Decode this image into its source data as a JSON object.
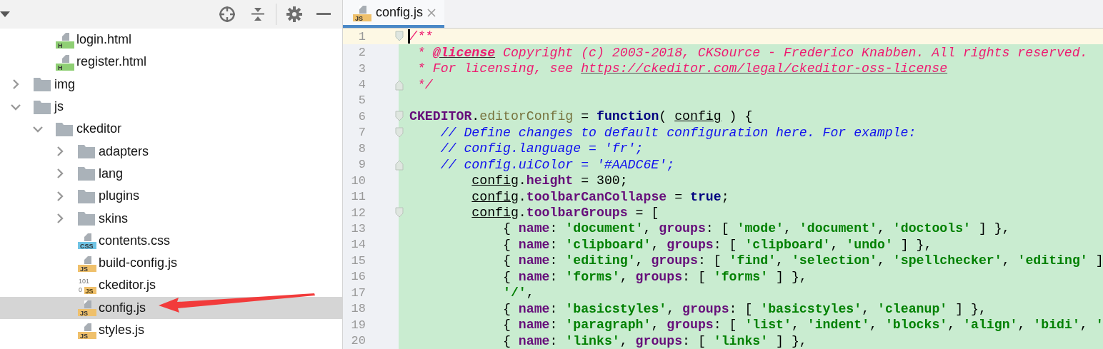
{
  "project_panel": {
    "tree": [
      {
        "children": [
          {
            "kind": "html-file",
            "name": "login.html",
            "badge": "H",
            "selected": false
          },
          {
            "kind": "html-file",
            "name": "register.html",
            "badge": "H",
            "selected": false
          }
        ]
      },
      {
        "kind": "folder",
        "name": "img",
        "expanded": false,
        "selected": false
      },
      {
        "kind": "folder",
        "name": "js",
        "expanded": true,
        "selected": false,
        "children": [
          {
            "kind": "folder",
            "name": "ckeditor",
            "expanded": true,
            "selected": false,
            "children": [
              {
                "kind": "folder",
                "name": "adapters",
                "expanded": false,
                "selected": false
              },
              {
                "kind": "folder",
                "name": "lang",
                "expanded": false,
                "selected": false
              },
              {
                "kind": "folder",
                "name": "plugins",
                "expanded": false,
                "selected": false
              },
              {
                "kind": "folder",
                "name": "skins",
                "expanded": false,
                "selected": false
              },
              {
                "kind": "css-file",
                "name": "contents.css",
                "badge": "CSS",
                "selected": false
              },
              {
                "kind": "js-file",
                "name": "build-config.js",
                "badge": "JS",
                "selected": false
              },
              {
                "kind": "binary-file",
                "name": "ckeditor.js",
                "badge": "JS",
                "bits": [
                  "101",
                  "0"
                ],
                "selected": false
              },
              {
                "kind": "js-file",
                "name": "config.js",
                "badge": "JS",
                "selected": true
              },
              {
                "kind": "js-file",
                "name": "styles.js",
                "badge": "JS",
                "selected": false
              }
            ]
          }
        ]
      }
    ]
  },
  "editor": {
    "tabs": [
      {
        "label": "config.js",
        "badge": "JS",
        "selected": true
      }
    ],
    "lines": [
      {
        "number": "1",
        "current": true,
        "fold_start": true,
        "fold_end": false,
        "tokens": [
          {
            "kind": "doc",
            "text": "/**"
          }
        ]
      },
      {
        "number": "2",
        "current": false,
        "fold_start": false,
        "fold_end": false,
        "tokens": [
          {
            "kind": "doc",
            "text": " * "
          },
          {
            "kind": "doctag",
            "text": "@license"
          },
          {
            "kind": "doc",
            "text": " Copyright (c) 2003-2018, CKSource - Frederico Knabben. All rights reserved."
          }
        ]
      },
      {
        "number": "3",
        "current": false,
        "fold_start": false,
        "fold_end": false,
        "tokens": [
          {
            "kind": "doc",
            "text": " * For licensing, see "
          },
          {
            "kind": "doclink",
            "text": "https://ckeditor.com/legal/ckeditor-oss-license"
          }
        ]
      },
      {
        "number": "4",
        "current": false,
        "fold_start": false,
        "fold_end": true,
        "tokens": [
          {
            "kind": "doc",
            "text": " */"
          }
        ]
      },
      {
        "number": "5",
        "current": false,
        "fold_start": false,
        "fold_end": false
      },
      {
        "number": "6",
        "current": false,
        "fold_start": true,
        "fold_end": false,
        "tokens": [
          {
            "kind": "global",
            "text": "CKEDITOR"
          },
          {
            "kind": "plain",
            "text": "."
          },
          {
            "kind": "method",
            "text": "editorConfig"
          },
          {
            "kind": "plain",
            "text": " = "
          },
          {
            "kind": "keyword",
            "text": "function"
          },
          {
            "kind": "plain",
            "text": "( "
          },
          {
            "kind": "param",
            "text": "config"
          },
          {
            "kind": "plain",
            "text": " ) {"
          }
        ]
      },
      {
        "number": "7",
        "current": false,
        "fold_start": true,
        "fold_end": false,
        "tokens": [
          {
            "kind": "comment",
            "text": "    // Define changes to default configuration here. For example:"
          }
        ]
      },
      {
        "number": "8",
        "current": false,
        "fold_start": false,
        "fold_end": false,
        "tokens": [
          {
            "kind": "comment",
            "text": "    // config.language = 'fr';"
          }
        ]
      },
      {
        "number": "9",
        "current": false,
        "fold_start": false,
        "fold_end": true,
        "tokens": [
          {
            "kind": "comment",
            "text": "    // config.uiColor = '#AADC6E';"
          }
        ]
      },
      {
        "number": "10",
        "current": false,
        "fold_start": false,
        "fold_end": false,
        "tokens": [
          {
            "kind": "param",
            "text": "        config"
          },
          {
            "kind": "plain",
            "text": "."
          },
          {
            "kind": "prop",
            "text": "height"
          },
          {
            "kind": "plain",
            "text": " = 300;"
          }
        ]
      },
      {
        "number": "11",
        "current": false,
        "fold_start": false,
        "fold_end": false,
        "tokens": [
          {
            "kind": "param",
            "text": "        config"
          },
          {
            "kind": "plain",
            "text": "."
          },
          {
            "kind": "prop",
            "text": "toolbarCanCollapse"
          },
          {
            "kind": "plain",
            "text": " = "
          },
          {
            "kind": "keyword",
            "text": "true"
          },
          {
            "kind": "plain",
            "text": ";"
          }
        ]
      },
      {
        "number": "12",
        "current": false,
        "fold_start": true,
        "fold_end": false,
        "tokens": [
          {
            "kind": "param",
            "text": "        config"
          },
          {
            "kind": "plain",
            "text": "."
          },
          {
            "kind": "prop",
            "text": "toolbarGroups"
          },
          {
            "kind": "plain",
            "text": " = ["
          }
        ]
      },
      {
        "number": "13",
        "current": false,
        "fold_start": false,
        "fold_end": false,
        "tokens": [
          {
            "kind": "plain",
            "text": "            { "
          },
          {
            "kind": "prop",
            "text": "name"
          },
          {
            "kind": "plain",
            "text": ": "
          },
          {
            "kind": "string",
            "text": "'document'"
          },
          {
            "kind": "plain",
            "text": ", "
          },
          {
            "kind": "prop",
            "text": "groups"
          },
          {
            "kind": "plain",
            "text": ": [ "
          },
          {
            "kind": "string",
            "text": "'mode'"
          },
          {
            "kind": "plain",
            "text": ", "
          },
          {
            "kind": "string",
            "text": "'document'"
          },
          {
            "kind": "plain",
            "text": ", "
          },
          {
            "kind": "string",
            "text": "'doctools'"
          },
          {
            "kind": "plain",
            "text": " ] },"
          }
        ]
      },
      {
        "number": "14",
        "current": false,
        "fold_start": false,
        "fold_end": false,
        "tokens": [
          {
            "kind": "plain",
            "text": "            { "
          },
          {
            "kind": "prop",
            "text": "name"
          },
          {
            "kind": "plain",
            "text": ": "
          },
          {
            "kind": "string",
            "text": "'clipboard'"
          },
          {
            "kind": "plain",
            "text": ", "
          },
          {
            "kind": "prop",
            "text": "groups"
          },
          {
            "kind": "plain",
            "text": ": [ "
          },
          {
            "kind": "string",
            "text": "'clipboard'"
          },
          {
            "kind": "plain",
            "text": ", "
          },
          {
            "kind": "string",
            "text": "'undo'"
          },
          {
            "kind": "plain",
            "text": " ] },"
          }
        ]
      },
      {
        "number": "15",
        "current": false,
        "fold_start": false,
        "fold_end": false,
        "tokens": [
          {
            "kind": "plain",
            "text": "            { "
          },
          {
            "kind": "prop",
            "text": "name"
          },
          {
            "kind": "plain",
            "text": ": "
          },
          {
            "kind": "string",
            "text": "'editing'"
          },
          {
            "kind": "plain",
            "text": ", "
          },
          {
            "kind": "prop",
            "text": "groups"
          },
          {
            "kind": "plain",
            "text": ": [ "
          },
          {
            "kind": "string",
            "text": "'find'"
          },
          {
            "kind": "plain",
            "text": ", "
          },
          {
            "kind": "string",
            "text": "'selection'"
          },
          {
            "kind": "plain",
            "text": ", "
          },
          {
            "kind": "string",
            "text": "'spellchecker'"
          },
          {
            "kind": "plain",
            "text": ", "
          },
          {
            "kind": "string",
            "text": "'editing'"
          },
          {
            "kind": "plain",
            "text": " ]"
          }
        ]
      },
      {
        "number": "16",
        "current": false,
        "fold_start": false,
        "fold_end": false,
        "tokens": [
          {
            "kind": "plain",
            "text": "            { "
          },
          {
            "kind": "prop",
            "text": "name"
          },
          {
            "kind": "plain",
            "text": ": "
          },
          {
            "kind": "string",
            "text": "'forms'"
          },
          {
            "kind": "plain",
            "text": ", "
          },
          {
            "kind": "prop",
            "text": "groups"
          },
          {
            "kind": "plain",
            "text": ": [ "
          },
          {
            "kind": "string",
            "text": "'forms'"
          },
          {
            "kind": "plain",
            "text": " ] },"
          }
        ]
      },
      {
        "number": "17",
        "current": false,
        "fold_start": false,
        "fold_end": false,
        "tokens": [
          {
            "kind": "string",
            "text": "            '/'"
          },
          {
            "kind": "plain",
            "text": ","
          }
        ]
      },
      {
        "number": "18",
        "current": false,
        "fold_start": false,
        "fold_end": false,
        "tokens": [
          {
            "kind": "plain",
            "text": "            { "
          },
          {
            "kind": "prop",
            "text": "name"
          },
          {
            "kind": "plain",
            "text": ": "
          },
          {
            "kind": "string",
            "text": "'basicstyles'"
          },
          {
            "kind": "plain",
            "text": ", "
          },
          {
            "kind": "prop",
            "text": "groups"
          },
          {
            "kind": "plain",
            "text": ": [ "
          },
          {
            "kind": "string",
            "text": "'basicstyles'"
          },
          {
            "kind": "plain",
            "text": ", "
          },
          {
            "kind": "string",
            "text": "'cleanup'"
          },
          {
            "kind": "plain",
            "text": " ] },"
          }
        ]
      },
      {
        "number": "19",
        "current": false,
        "fold_start": false,
        "fold_end": false,
        "tokens": [
          {
            "kind": "plain",
            "text": "            { "
          },
          {
            "kind": "prop",
            "text": "name"
          },
          {
            "kind": "plain",
            "text": ": "
          },
          {
            "kind": "string",
            "text": "'paragraph'"
          },
          {
            "kind": "plain",
            "text": ", "
          },
          {
            "kind": "prop",
            "text": "groups"
          },
          {
            "kind": "plain",
            "text": ": [ "
          },
          {
            "kind": "string",
            "text": "'list'"
          },
          {
            "kind": "plain",
            "text": ", "
          },
          {
            "kind": "string",
            "text": "'indent'"
          },
          {
            "kind": "plain",
            "text": ", "
          },
          {
            "kind": "string",
            "text": "'blocks'"
          },
          {
            "kind": "plain",
            "text": ", "
          },
          {
            "kind": "string",
            "text": "'align'"
          },
          {
            "kind": "plain",
            "text": ", "
          },
          {
            "kind": "string",
            "text": "'bidi'"
          },
          {
            "kind": "plain",
            "text": ", "
          },
          {
            "kind": "string",
            "text": "'"
          }
        ]
      },
      {
        "number": "20",
        "current": false,
        "fold_start": false,
        "fold_end": false,
        "tokens": [
          {
            "kind": "plain",
            "text": "            { "
          },
          {
            "kind": "prop",
            "text": "name"
          },
          {
            "kind": "plain",
            "text": ": "
          },
          {
            "kind": "string",
            "text": "'links'"
          },
          {
            "kind": "plain",
            "text": ", "
          },
          {
            "kind": "prop",
            "text": "groups"
          },
          {
            "kind": "plain",
            "text": ": [ "
          },
          {
            "kind": "string",
            "text": "'links'"
          },
          {
            "kind": "plain",
            "text": " ] },"
          }
        ]
      }
    ]
  }
}
